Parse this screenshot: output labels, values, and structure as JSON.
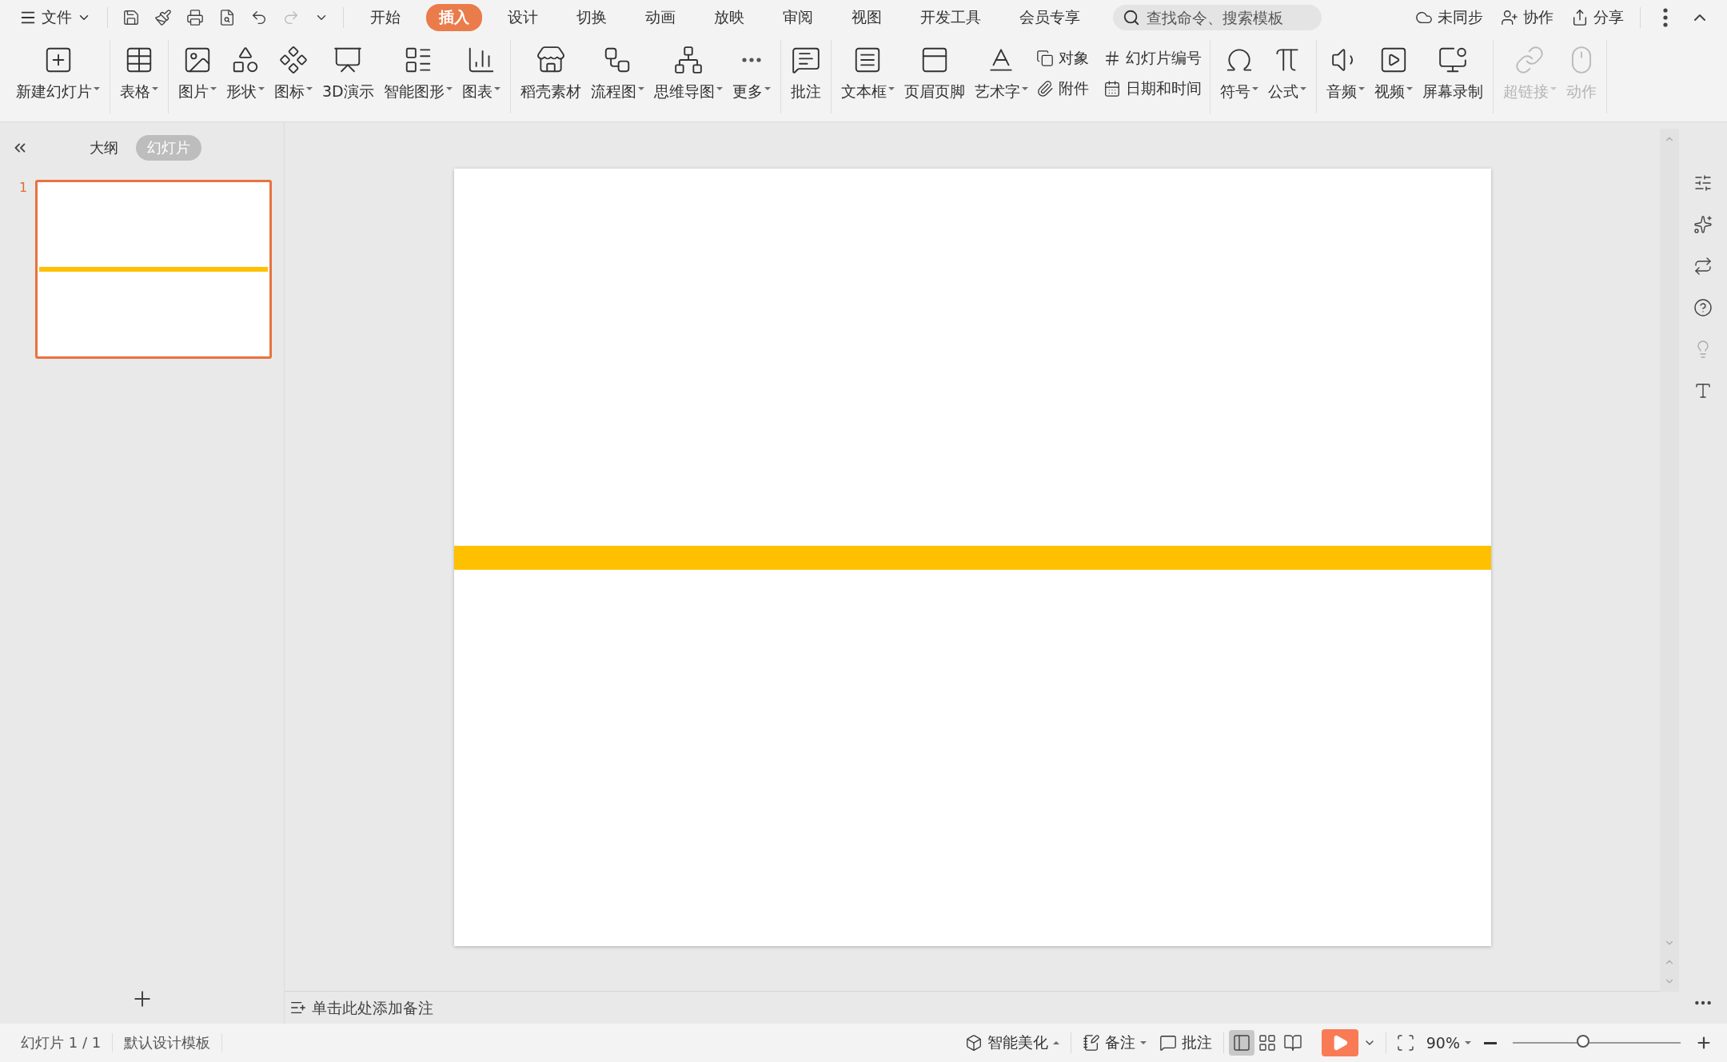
{
  "menu_bar": {
    "file_label": "文件",
    "tabs": [
      {
        "label": "开始",
        "selected": false
      },
      {
        "label": "插入",
        "selected": true
      },
      {
        "label": "设计",
        "selected": false
      },
      {
        "label": "切换",
        "selected": false
      },
      {
        "label": "动画",
        "selected": false
      },
      {
        "label": "放映",
        "selected": false
      },
      {
        "label": "审阅",
        "selected": false
      },
      {
        "label": "视图",
        "selected": false
      },
      {
        "label": "开发工具",
        "selected": false
      },
      {
        "label": "会员专享",
        "selected": false
      }
    ],
    "search": {
      "placeholder": "查找命令、搜索模板"
    },
    "actions": [
      {
        "label": "未同步"
      },
      {
        "label": "协作"
      },
      {
        "label": "分享"
      }
    ]
  },
  "ribbon": [
    {
      "items": [
        {
          "kind": "large",
          "label": "新建幻灯片",
          "dropdown": true,
          "disabled": false
        }
      ]
    },
    {
      "items": [
        {
          "kind": "large",
          "label": "表格",
          "dropdown": true,
          "disabled": false
        }
      ]
    },
    {
      "items": [
        {
          "kind": "large",
          "label": "图片",
          "dropdown": true,
          "disabled": false
        },
        {
          "kind": "large",
          "label": "形状",
          "dropdown": true,
          "disabled": false
        },
        {
          "kind": "large",
          "label": "图标",
          "dropdown": true,
          "disabled": false
        },
        {
          "kind": "large",
          "label": "3D演示",
          "dropdown": false,
          "disabled": false
        },
        {
          "kind": "large",
          "label": "智能图形",
          "dropdown": true,
          "disabled": false
        },
        {
          "kind": "large",
          "label": "图表",
          "dropdown": true,
          "disabled": false
        }
      ]
    },
    {
      "items": [
        {
          "kind": "large",
          "label": "稻壳素材",
          "dropdown": false,
          "disabled": false
        },
        {
          "kind": "large",
          "label": "流程图",
          "dropdown": true,
          "disabled": false
        },
        {
          "kind": "large",
          "label": "思维导图",
          "dropdown": true,
          "disabled": false
        },
        {
          "kind": "large",
          "label": "更多",
          "dropdown": true,
          "disabled": false
        }
      ]
    },
    {
      "items": [
        {
          "kind": "large",
          "label": "批注",
          "dropdown": false,
          "disabled": false
        }
      ]
    },
    {
      "items": [
        {
          "kind": "large",
          "label": "文本框",
          "dropdown": true,
          "disabled": false
        },
        {
          "kind": "large",
          "label": "页眉页脚",
          "dropdown": false,
          "disabled": false
        },
        {
          "kind": "large",
          "label": "艺术字",
          "dropdown": true,
          "disabled": false
        },
        {
          "kind": "small",
          "label": "对象",
          "dropdown": false,
          "disabled": false
        },
        {
          "kind": "small",
          "label": "附件",
          "dropdown": false,
          "disabled": false
        },
        {
          "kind": "small",
          "label": "幻灯片编号",
          "dropdown": false,
          "disabled": false
        },
        {
          "kind": "small",
          "label": "日期和时间",
          "dropdown": false,
          "disabled": false
        }
      ]
    },
    {
      "items": [
        {
          "kind": "large",
          "label": "符号",
          "dropdown": true,
          "disabled": false
        },
        {
          "kind": "large",
          "label": "公式",
          "dropdown": true,
          "disabled": false
        }
      ]
    },
    {
      "items": [
        {
          "kind": "large",
          "label": "音频",
          "dropdown": true,
          "disabled": false
        },
        {
          "kind": "large",
          "label": "视频",
          "dropdown": true,
          "disabled": false
        },
        {
          "kind": "large",
          "label": "屏幕录制",
          "dropdown": false,
          "disabled": false
        }
      ]
    },
    {
      "items": [
        {
          "kind": "large",
          "label": "超链接",
          "dropdown": true,
          "disabled": true
        },
        {
          "kind": "large",
          "label": "动作",
          "dropdown": false,
          "disabled": true
        }
      ]
    }
  ],
  "left_panel": {
    "tabs": [
      {
        "label": "大纲",
        "selected": false
      },
      {
        "label": "幻灯片",
        "selected": true
      }
    ],
    "slides": [
      {
        "number": "1",
        "selected": true
      }
    ]
  },
  "notes": {
    "placeholder": "单击此处添加备注"
  },
  "status_bar": {
    "slide_info": "幻灯片 1 / 1",
    "template": "默认设计模板",
    "beautify": "智能美化",
    "notes": "备注",
    "comments": "批注",
    "views": [
      {
        "selected": true
      },
      {
        "selected": false
      },
      {
        "selected": false
      }
    ],
    "zoom": "90%",
    "zoom_slider": {
      "level": 0.43
    }
  }
}
